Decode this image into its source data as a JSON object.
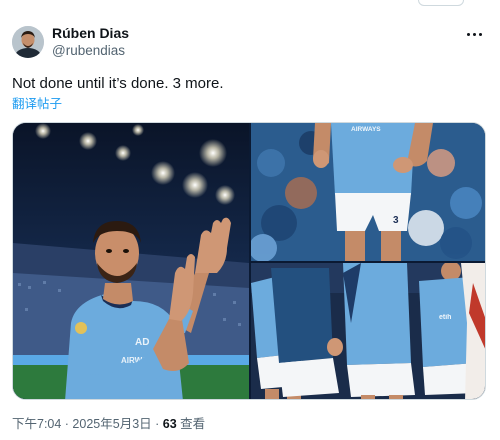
{
  "author": {
    "display_name": "Rúben Dias",
    "handle": "@rubendias",
    "avatar_icon": "user-avatar"
  },
  "post": {
    "text": "Not done until it’s done. 3 more.",
    "translate_label": "翻译帖子",
    "media": [
      {
        "id": "photo-1",
        "description": "player-applauding-stadium",
        "shirt_text": "ETIHAD AIRWAYS"
      },
      {
        "id": "photo-2",
        "description": "player-torso-crowd",
        "shirt_text": "ETIHAD AIRWAYS"
      },
      {
        "id": "photo-3",
        "description": "team-walking-out",
        "shirt_text": "ETIHAD AIRWAYS"
      }
    ],
    "timestamp": "下午7:04 · 2025年5月3日 · ",
    "views_count": "63",
    "views_label": " 查看"
  },
  "colors": {
    "text_primary": "#0f1419",
    "text_secondary": "#536471",
    "accent": "#1d9bf0",
    "kit_sky_blue": "#6cabdd"
  },
  "icons": {
    "more": "more-horizontal-icon"
  }
}
